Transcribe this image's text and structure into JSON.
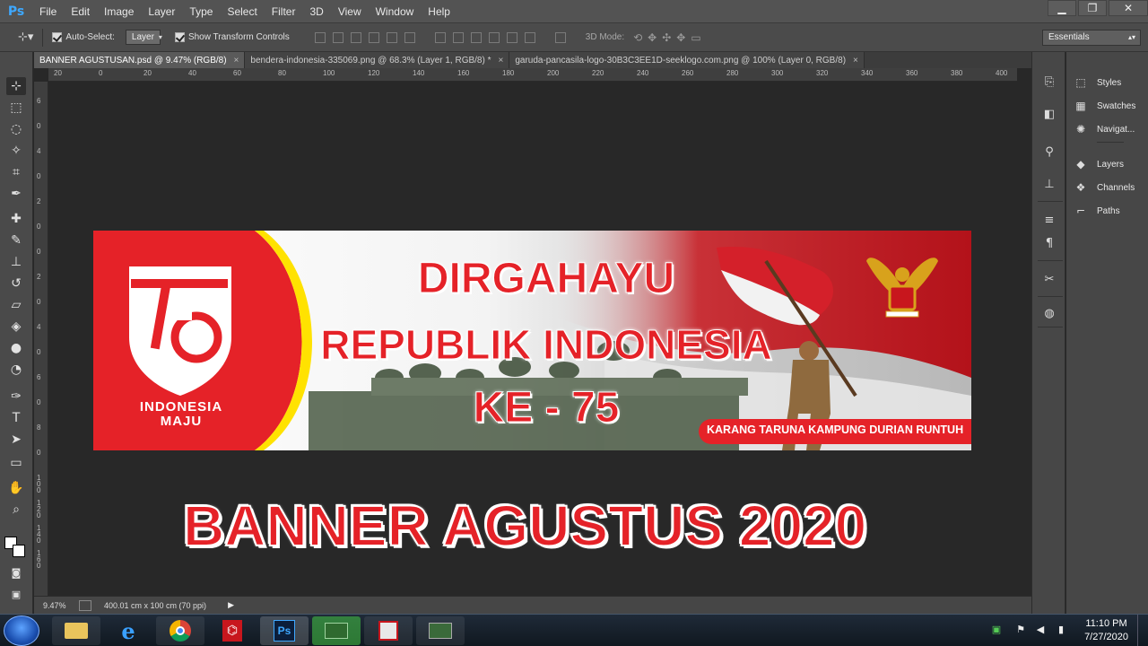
{
  "app": {
    "logo": "Ps"
  },
  "menu": [
    "File",
    "Edit",
    "Image",
    "Layer",
    "Type",
    "Select",
    "Filter",
    "3D",
    "View",
    "Window",
    "Help"
  ],
  "window_controls": {
    "minimize": "▁",
    "restore": "❐",
    "close": "✕"
  },
  "options_bar": {
    "auto_select_label": "Auto-Select:",
    "auto_select_value": "Layer",
    "show_transform_label": "Show Transform Controls",
    "mode_label": "3D Mode:",
    "workspace": "Essentials"
  },
  "tabs": [
    {
      "label": "BANNER AGUSTUSAN.psd @ 9.47% (RGB/8)",
      "active": true
    },
    {
      "label": "bendera-indonesia-335069.png @ 68.3% (Layer 1, RGB/8) *",
      "active": false
    },
    {
      "label": "garuda-pancasila-logo-30B3C3EE1D-seeklogo.com.png @ 100% (Layer 0, RGB/8)",
      "active": false
    }
  ],
  "ruler_h_ticks": [
    "20",
    "0",
    "20",
    "40",
    "60",
    "80",
    "100",
    "120",
    "140",
    "160",
    "180",
    "200",
    "220",
    "240",
    "260",
    "280",
    "300",
    "320",
    "340",
    "360",
    "380",
    "400"
  ],
  "ruler_v_ticks": [
    "6",
    "0",
    "4",
    "0",
    "2",
    "0",
    "0",
    "2",
    "0",
    "4",
    "0",
    "6",
    "0",
    "8",
    "0",
    "1 0 0",
    "1 2 0",
    "1 4 0",
    "1 6 0"
  ],
  "banner": {
    "logo_number": "75",
    "logo_line1": "INDONESIA",
    "logo_line2": "MAJU",
    "line1": "DIRGAHAYU",
    "line2": "REPUBLIK INDONESIA",
    "line3": "KE - 75",
    "footer": "KARANG TARUNA KAMPUNG DURIAN RUNTUH"
  },
  "overlay_title": "BANNER AGUSTUS 2020",
  "status": {
    "zoom": "9.47%",
    "doc_info": "400.01 cm x 100 cm (70 ppi)"
  },
  "panels": [
    {
      "label": "Styles",
      "icon": "styles-icon"
    },
    {
      "label": "Swatches",
      "icon": "swatches-icon"
    },
    {
      "label": "Navigat...",
      "icon": "navigator-icon"
    },
    {
      "label": "Layers",
      "icon": "layers-icon"
    },
    {
      "label": "Channels",
      "icon": "channels-icon"
    },
    {
      "label": "Paths",
      "icon": "paths-icon"
    }
  ],
  "taskbar": {
    "time": "11:10 PM",
    "date": "7/27/2020"
  },
  "colors": {
    "accent_red": "#e52228",
    "banner_yellow": "#ffe200",
    "ps_blue": "#3ea8ff"
  }
}
